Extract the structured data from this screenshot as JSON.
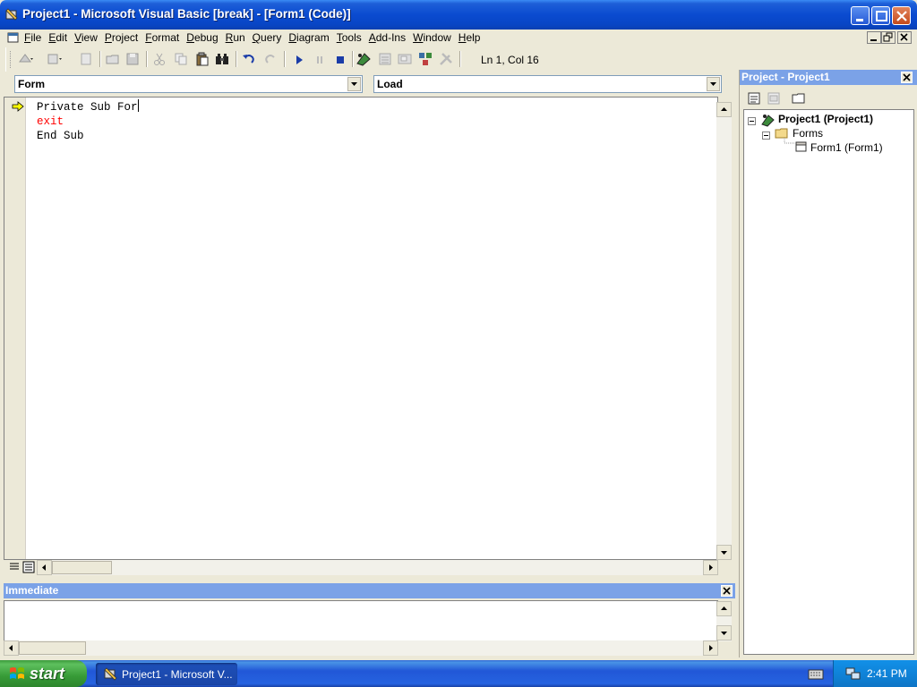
{
  "window": {
    "title": "Project1 - Microsoft Visual Basic [break] - [Form1 (Code)]"
  },
  "menu": {
    "items": [
      "File",
      "Edit",
      "View",
      "Project",
      "Format",
      "Debug",
      "Run",
      "Query",
      "Diagram",
      "Tools",
      "Add-Ins",
      "Window",
      "Help"
    ]
  },
  "toolbar": {
    "position": "Ln 1, Col 16"
  },
  "code_window": {
    "object_combo": "Form",
    "procedure_combo": "Load",
    "lines": [
      {
        "text": "Private Sub For",
        "style": "normal"
      },
      {
        "text": "exit",
        "style": "error"
      },
      {
        "text": "End Sub",
        "style": "normal"
      }
    ]
  },
  "project_panel": {
    "title": "Project - Project1",
    "tree": {
      "root": "Project1 (Project1)",
      "folder": "Forms",
      "leaf": "Form1 (Form1)"
    }
  },
  "immediate": {
    "title": "Immediate"
  },
  "taskbar": {
    "start_label": "start",
    "task_item": "Project1 - Microsoft V...",
    "clock": "2:41 PM"
  },
  "colors": {
    "titlebar": "#0A4BD0",
    "panel_header": "#7BA2E7",
    "error_text": "#FF0000",
    "taskbar": "#2157D7",
    "start_button": "#379B37"
  }
}
